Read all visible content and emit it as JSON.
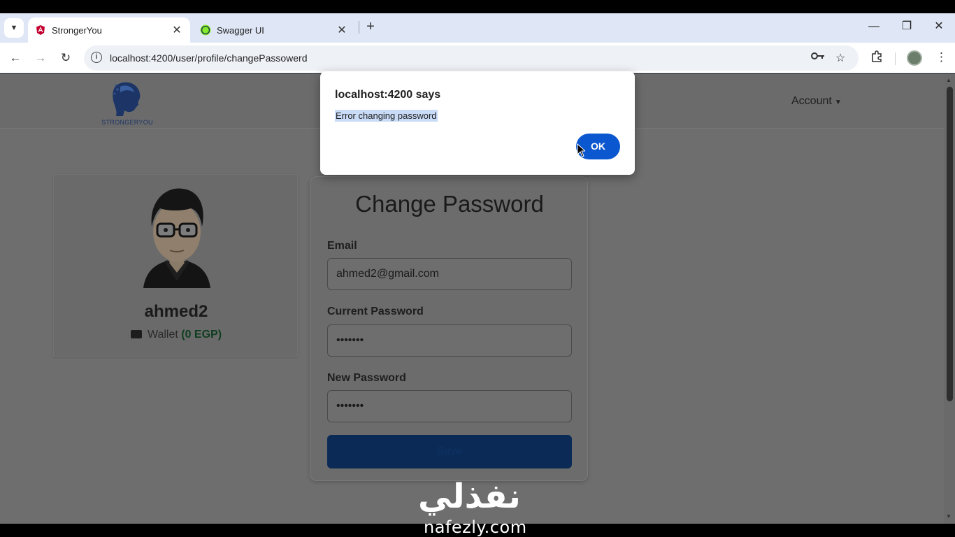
{
  "browser": {
    "tabs": [
      {
        "title": "StrongerYou",
        "active": true,
        "favicon": "angular-icon"
      },
      {
        "title": "Swagger UI",
        "active": false,
        "favicon": "swagger-icon"
      }
    ],
    "url": "localhost:4200/user/profile/changePassowerd"
  },
  "navbar": {
    "logo_text": "STRONGERYOU",
    "account_label": "Account"
  },
  "profile": {
    "username": "ahmed2",
    "wallet_label": "Wallet",
    "wallet_amount": "(0 EGP)"
  },
  "change_password": {
    "title": "Change Password",
    "email_label": "Email",
    "email_value": "ahmed2@gmail.com",
    "current_label": "Current Password",
    "current_value": "•••••••",
    "new_label": "New Password",
    "new_value": "•••••••",
    "submit_label": "Save"
  },
  "dialog": {
    "title": "localhost:4200 says",
    "message": "Error changing password",
    "ok_label": "OK"
  },
  "watermark": {
    "arabic": "نفذلي",
    "latin": "nafezly.com"
  },
  "colors": {
    "accent": "#0b57d0",
    "tabstrip": "#dfe6f5",
    "overlay": "#6e6e6e"
  }
}
